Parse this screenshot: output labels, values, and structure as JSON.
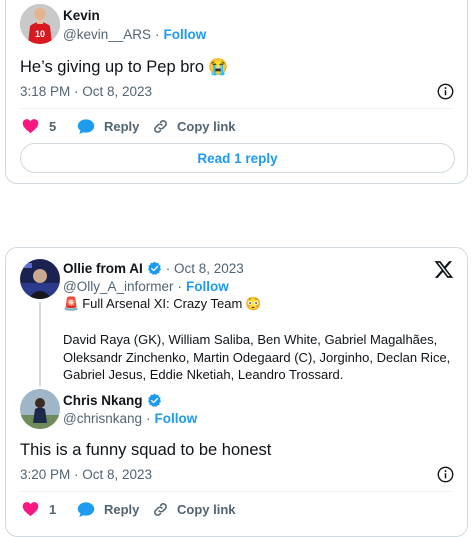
{
  "tweet1": {
    "user_name": "Kevin",
    "handle": "@kevin__ARS",
    "separator": "·",
    "follow_label": "Follow",
    "text": "He’s giving up to Pep bro",
    "emoji": "😭",
    "timestamp": "3:18 PM · Oct 8, 2023",
    "like_count": "5",
    "reply_label": "Reply",
    "copy_link_label": "Copy link",
    "read_replies_label": "Read 1 reply"
  },
  "tweet2": {
    "quoted": {
      "user_name": "Ollie from AI",
      "date": "· Oct 8, 2023",
      "handle": "@Olly_A_informer",
      "separator": "·",
      "follow_label": "Follow",
      "headline_emoji": "🚨",
      "headline": "Full Arsenal XI: Crazy Team",
      "headline_trailing_emoji": "😳",
      "lineup_lines": [
        "David Raya (GK), William Saliba, Ben White, Gabriel Magalhães,",
        "Oleksandr Zinchenko, Martin Odegaard (C), Jorginho, Declan Rice,",
        "Gabriel Jesus, Eddie Nketiah, Leandro Trossard."
      ]
    },
    "user_name": "Chris Nkang",
    "handle": "@chrisnkang",
    "separator": "·",
    "follow_label": "Follow",
    "text": "This is a funny squad to be honest",
    "timestamp": "3:20 PM · Oct 8, 2023",
    "like_count": "1",
    "reply_label": "Reply",
    "copy_link_label": "Copy link"
  },
  "colors": {
    "accent": "#1d9bf0",
    "like": "#f91880",
    "text": "#0f1419",
    "muted": "#536471",
    "border": "#cfd9de"
  },
  "icons": [
    "x-logo-icon",
    "verified-badge-icon",
    "info-icon",
    "heart-icon",
    "reply-bubble-icon",
    "link-icon"
  ]
}
